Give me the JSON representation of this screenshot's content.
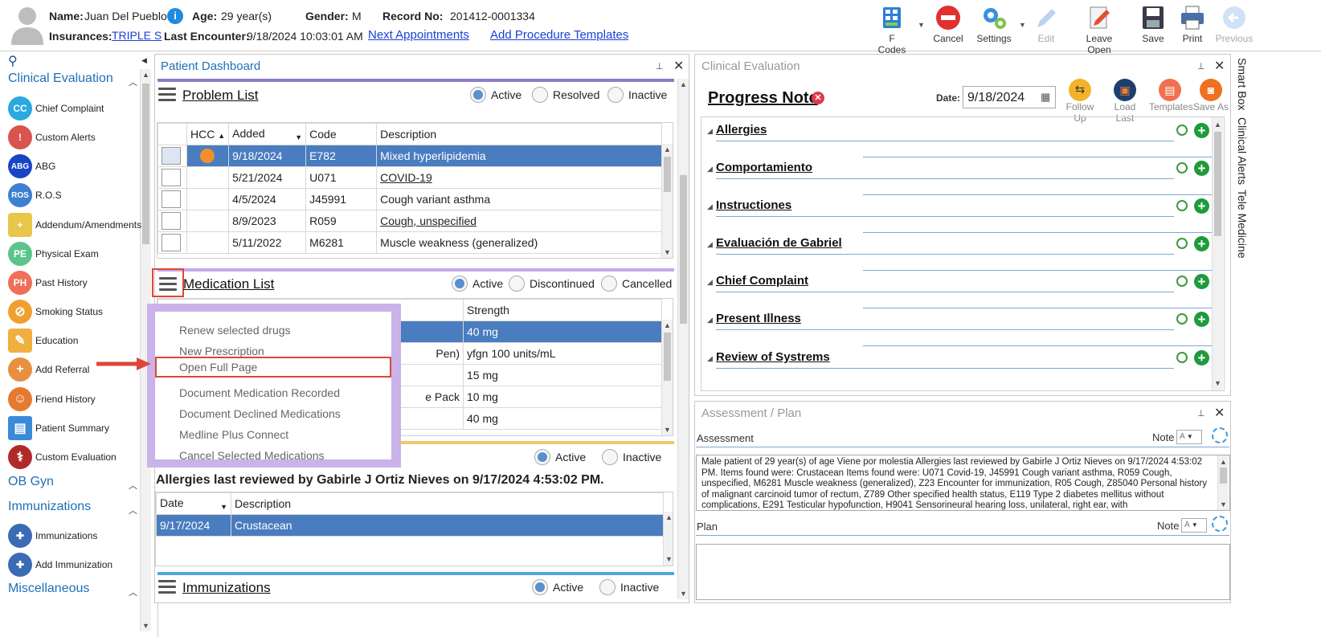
{
  "header": {
    "name_label": "Name:",
    "name": "Juan Del Pueblo",
    "age_label": "Age:",
    "age": "29 year(s)",
    "gender_label": "Gender:",
    "gender": "M",
    "record_label": "Record No:",
    "record": "201412-0001334",
    "insurances_label": "Insurances:",
    "insurance": "TRIPLE S",
    "last_encounter_label": "Last Encounter:",
    "last_encounter": "9/18/2024 10:03:01 AM",
    "next_appointments": "Next Appointments",
    "add_procedure_templates": "Add Procedure Templates"
  },
  "toolbar": {
    "fcodes": "F Codes",
    "cancel": "Cancel",
    "settings": "Settings",
    "edit": "Edit",
    "leave_open": "Leave Open",
    "save": "Save",
    "print": "Print",
    "previous": "Previous"
  },
  "nav": {
    "sections": [
      "Clinical Evaluation",
      "OB Gyn",
      "Immunizations",
      "Miscellaneous"
    ],
    "items": [
      {
        "label": "Chief Complaint",
        "badge": "CC",
        "color": "#29a9e0"
      },
      {
        "label": "Custom Alerts",
        "badge": "!",
        "color": "#d9534f"
      },
      {
        "label": "ABG",
        "badge": "ABG",
        "color": "#1a44c8"
      },
      {
        "label": "R.O.S",
        "badge": "ROS",
        "color": "#3f7fd0"
      },
      {
        "label": "Addendum/Amendments",
        "badge": "+",
        "color": "#e8c64a"
      },
      {
        "label": "Physical Exam",
        "badge": "PE",
        "color": "#5cc48a"
      },
      {
        "label": "Past History",
        "badge": "PH",
        "color": "#ef6f5a"
      },
      {
        "label": "Smoking Status",
        "badge": "⊘",
        "color": "#f0a030"
      },
      {
        "label": "Education",
        "badge": "✎",
        "color": "#f0b040"
      },
      {
        "label": "Add Referral",
        "badge": "+",
        "color": "#e89040"
      },
      {
        "label": "Friend History",
        "badge": "☺",
        "color": "#e57a30"
      },
      {
        "label": "Patient Summary",
        "badge": "▤",
        "color": "#3b8ad9"
      },
      {
        "label": "Custom Evaluation",
        "badge": "⚕",
        "color": "#b02a2a"
      },
      {
        "label": "Immunizations",
        "badge": "✚",
        "color": "#3b6bb5"
      },
      {
        "label": "Add Immunization",
        "badge": "✚",
        "color": "#3b6bb5"
      }
    ]
  },
  "dashboard": {
    "title": "Patient Dashboard",
    "problem_list": {
      "title": "Problem List",
      "filters": [
        "Active",
        "Resolved",
        "Inactive"
      ],
      "columns": [
        "HCC",
        "Added",
        "Code",
        "Description"
      ],
      "rows": [
        {
          "added": "9/18/2024",
          "code": "E782",
          "description": "Mixed hyperlipidemia"
        },
        {
          "added": "5/21/2024",
          "code": "U071",
          "description": "COVID-19"
        },
        {
          "added": "4/5/2024",
          "code": "J45991",
          "description": "Cough variant asthma"
        },
        {
          "added": "8/9/2023",
          "code": "R059",
          "description": "Cough, unspecified"
        },
        {
          "added": "5/11/2022",
          "code": "M6281",
          "description": "Muscle weakness (generalized)"
        }
      ]
    },
    "medication_list": {
      "title": "Medication List",
      "filters": [
        "Active",
        "Discontinued",
        "Cancelled"
      ],
      "strength_header": "Strength",
      "rows": [
        {
          "name": "",
          "strength": "40 mg"
        },
        {
          "name": "Pen)",
          "strength": "yfgn 100 units/mL"
        },
        {
          "name": "",
          "strength": "15 mg"
        },
        {
          "name": "e Pack",
          "strength": "10 mg"
        },
        {
          "name": "",
          "strength": "40 mg"
        }
      ]
    },
    "menu": [
      "Renew selected drugs",
      "New Prescription",
      "Open Full Page",
      "Document Medication Recorded",
      "Document Declined Medications",
      "Medline Plus Connect",
      "Cancel Selected Medications"
    ],
    "allergies": {
      "filters": [
        "Active",
        "Inactive"
      ],
      "review_text": "Allergies last reviewed by Gabirle J Ortiz Nieves on 9/17/2024 4:53:02 PM.",
      "columns": [
        "Date",
        "Description"
      ],
      "rows": [
        {
          "date": "9/17/2024",
          "description": "Crustacean"
        }
      ]
    },
    "immunizations": {
      "title": "Immunizations",
      "filters": [
        "Active",
        "Inactive"
      ]
    }
  },
  "clinical": {
    "title": "Clinical Evaluation",
    "note_title": "Progress Note",
    "date_label": "Date:",
    "date": "9/18/2024",
    "actions": [
      "Follow Up",
      "Load Last",
      "Templates",
      "Save As"
    ],
    "sections": [
      "Allergies",
      "Comportamiento",
      "Instructiones",
      "Evaluación de Gabriel",
      "Chief Complaint",
      "Present Illness",
      "Review of Systrems"
    ]
  },
  "assessment": {
    "title": "Assessment / Plan",
    "assessment_label": "Assessment",
    "note_label": "Note",
    "assessment_text": "Male patient of 29 year(s) of age Viene por molestia     Allergies last reviewed by Gabirle J Ortiz Nieves on 9/17/2024 4:53:02 PM.    Items found were:  Crustacean  Items found were:  U071 Covid-19, J45991 Cough variant asthma, R059 Cough, unspecified, M6281 Muscle weakness (generalized), Z23 Encounter for immunization, R05 Cough, Z85040 Personal history of malignant carcinoid tumor of rectum, Z789 Other specified health status, E119 Type 2 diabetes mellitus without complications, E291 Testicular hypofunction, H9041 Sensorineural hearing loss, unilateral, right ear, with",
    "plan_label": "Plan"
  },
  "right_tabs": [
    "Smart Box",
    "Clinical Alerts",
    "Tele Medicine"
  ]
}
